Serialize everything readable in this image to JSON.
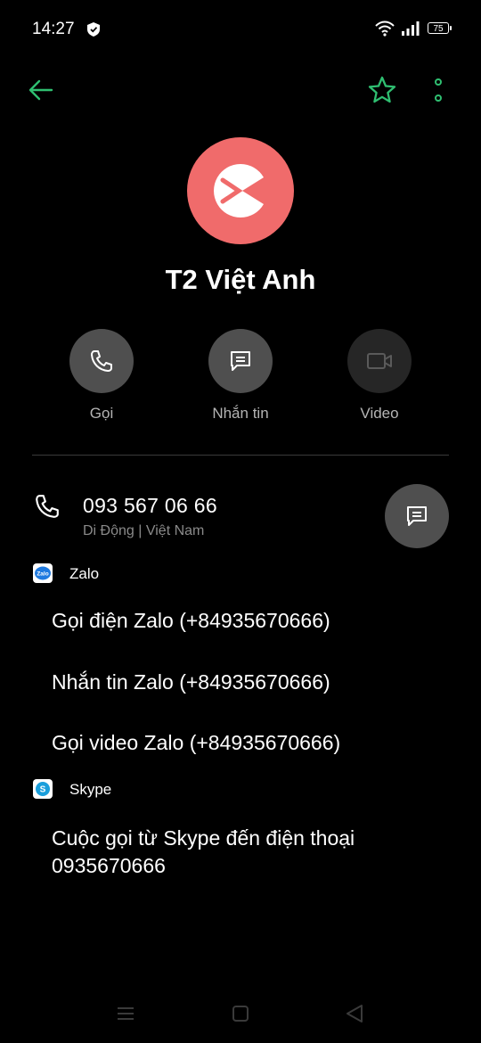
{
  "status_bar": {
    "time": "14:27",
    "battery": "75"
  },
  "contact": {
    "name": "T2 Việt Anh",
    "avatar_color": "#f06b6b"
  },
  "actions": {
    "call_label": "Gọi",
    "message_label": "Nhắn tin",
    "video_label": "Video"
  },
  "phone": {
    "number": "093 567 06 66",
    "type": "Di Động | Việt Nam"
  },
  "zalo": {
    "title": "Zalo",
    "icon_text": "Zalo",
    "items": [
      "Gọi điện Zalo (+84935670666)",
      "Nhắn tin Zalo (+84935670666)",
      "Gọi video Zalo (+84935670666)"
    ]
  },
  "skype": {
    "title": "Skype",
    "icon_text": "S",
    "items": [
      "Cuộc gọi từ Skype đến điện thoại 0935670666"
    ]
  },
  "colors": {
    "accent": "#2fbf71",
    "background": "#000000",
    "button": "#4f4f4f"
  }
}
